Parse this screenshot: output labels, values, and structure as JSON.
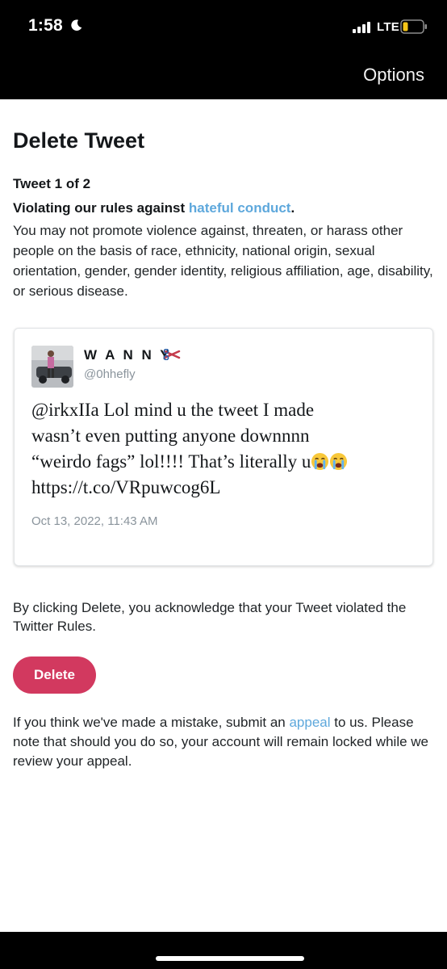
{
  "status_bar": {
    "time": "1:58",
    "network": "LTE",
    "icons": [
      "moon-icon",
      "signal-icon",
      "battery-icon"
    ]
  },
  "header": {
    "options_label": "Options"
  },
  "page": {
    "title": "Delete Tweet",
    "counter": "Tweet 1 of 2",
    "violation_prefix": "Violating our rules against ",
    "violation_link": "hateful conduct",
    "violation_suffix": ".",
    "rule_description": "You may not promote violence against, threaten, or harass other people on the basis of race, ethnicity, national origin, sexual orientation, gender, gender identity, religious affiliation, age, disability, or serious disease."
  },
  "tweet": {
    "display_name": "W A N N Y",
    "name_emoji": "scissors-emoji",
    "handle": "@0hhefly",
    "text_line1": "@irkxIIa Lol mind u the tweet I made",
    "text_line2": "wasn’t even putting anyone downnnn",
    "text_line3": "“weirdo fags” lol!!!! That’s literally u",
    "text_emojis": [
      "crying-emoji",
      "crying-emoji"
    ],
    "text_line4": "https://t.co/VRpuwcog6L",
    "date": "Oct 13, 2022, 11:43 AM"
  },
  "acknowledgement": "By clicking Delete, you acknowledge that your Tweet violated the Twitter Rules.",
  "delete_button_label": "Delete",
  "appeal": {
    "prefix": "If you think we've made a mistake, submit an ",
    "link": "appeal",
    "suffix": " to us. Please note that should you do so, your account will remain locked while we review your appeal."
  },
  "colors": {
    "accent_link": "#5ea8dc",
    "delete_button": "#d2395f",
    "bars": "#000000"
  }
}
